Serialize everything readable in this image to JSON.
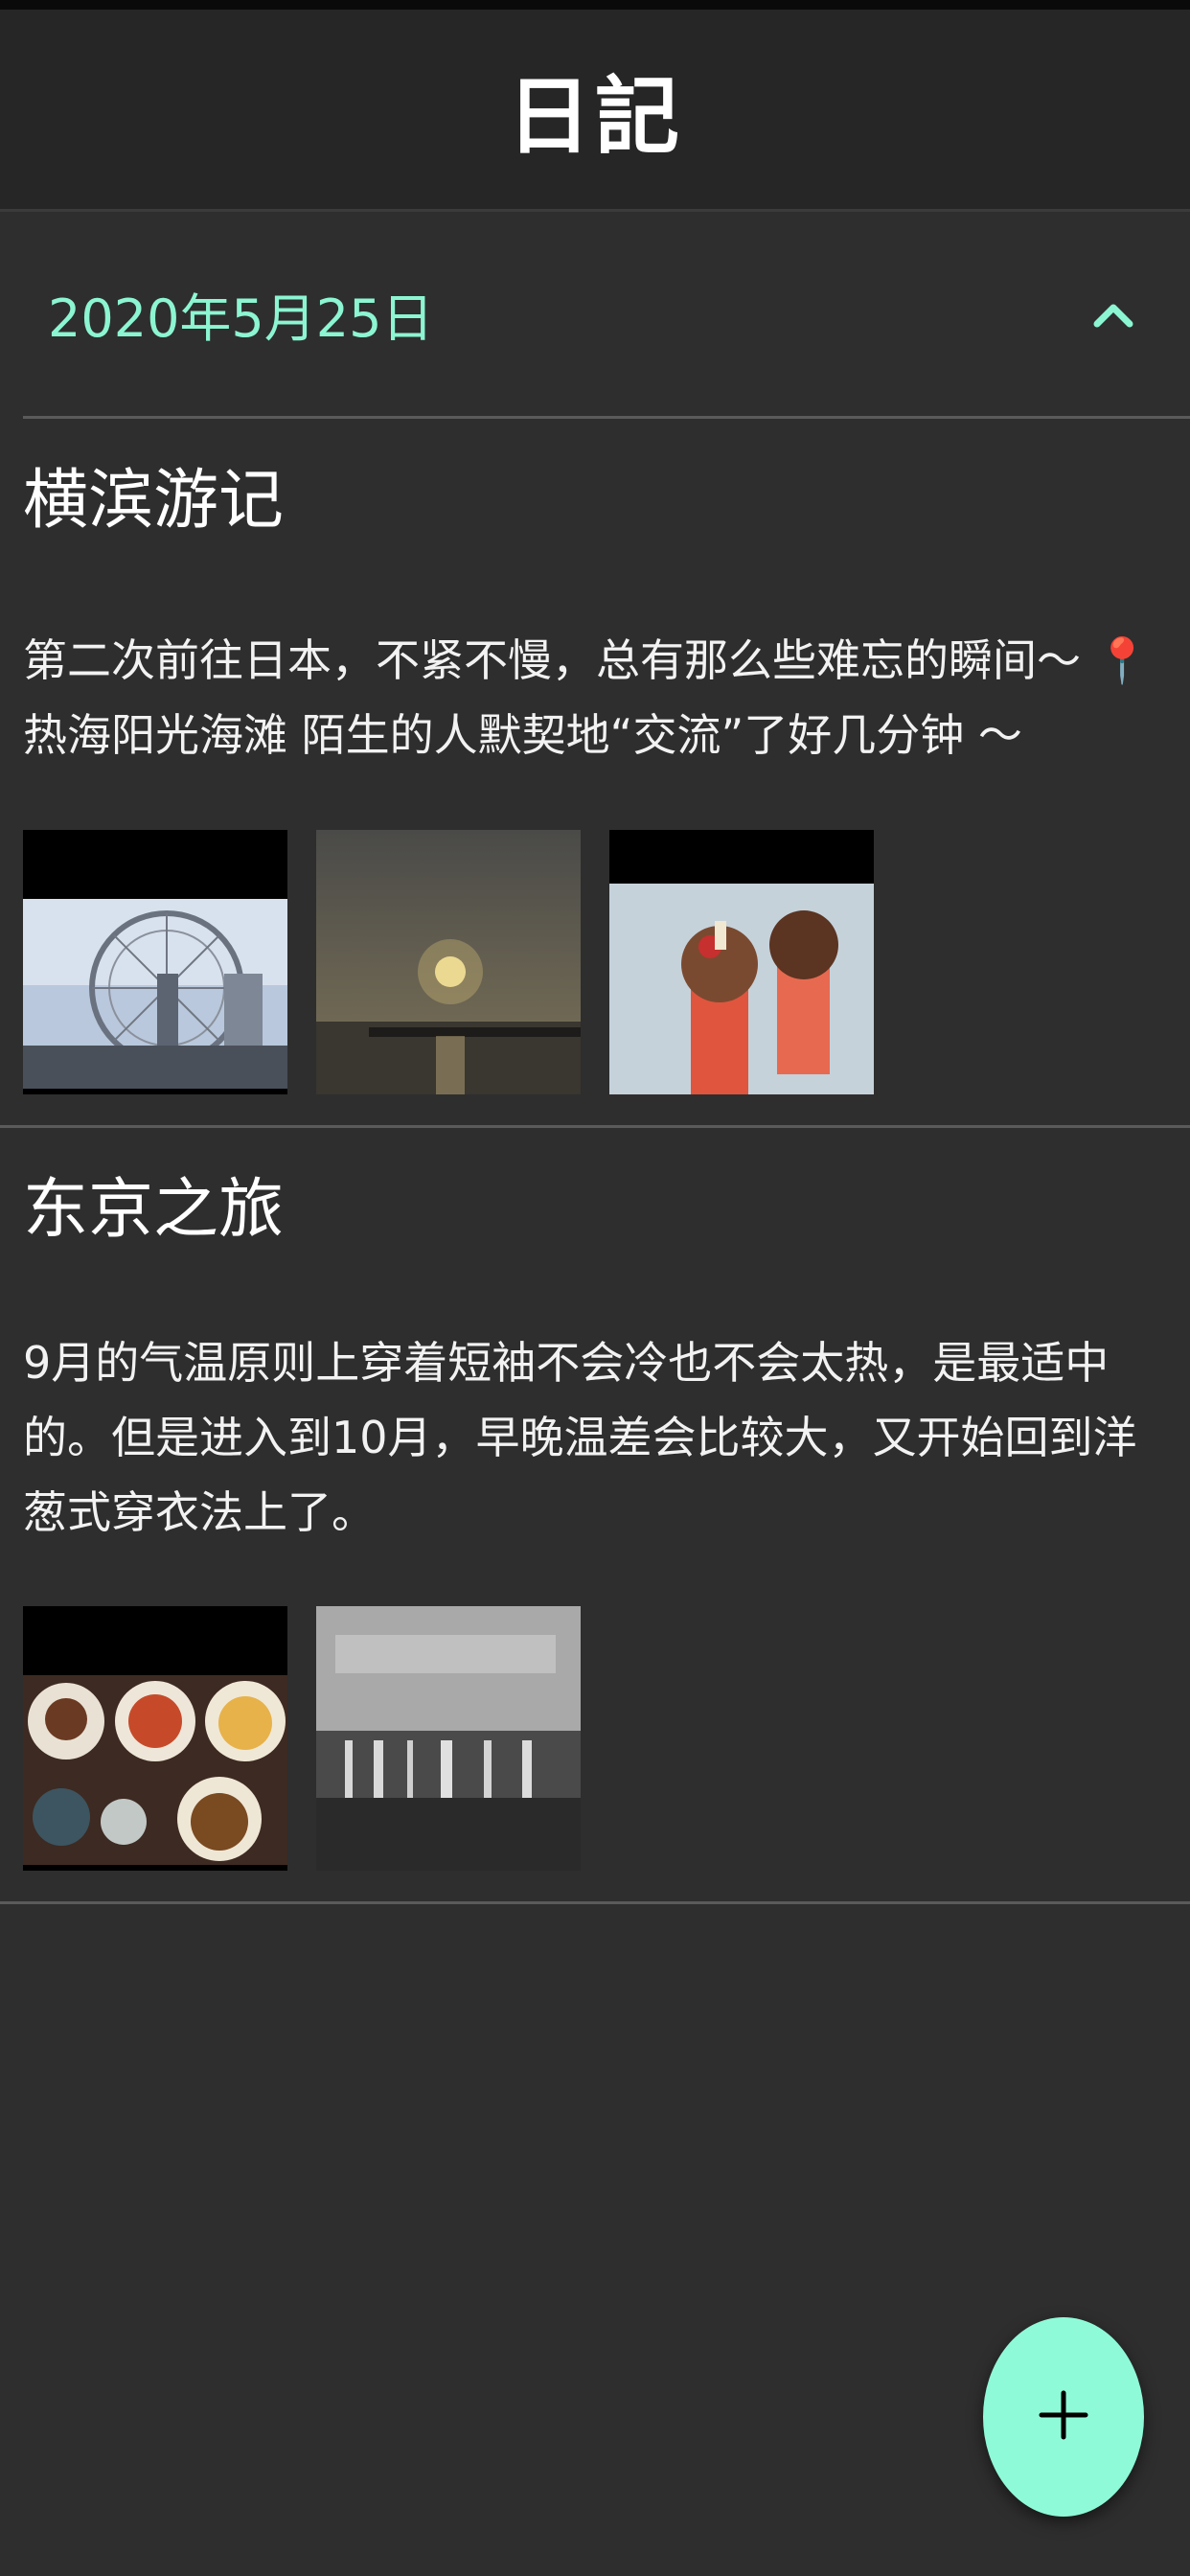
{
  "header": {
    "title": "日記"
  },
  "section": {
    "date": "2020年5月25日",
    "toggle_icon": "chevron-up-icon"
  },
  "entries": [
    {
      "title": "横滨游记",
      "body": "第二次前往日本，不紧不慢，总有那么些难忘的瞬间～ 📍热海阳光海滩 陌生的人默契地“交流”了好几分钟 ～",
      "photos": [
        "ferris-wheel-photo",
        "sunset-sea-photo",
        "ice-cream-photo"
      ]
    },
    {
      "title": "东京之旅",
      "body": "9月的气温原则上穿着短袖不会冷也不会太热，是最适中的。但是进入到10月，早晚温差会比较大，又开始回到洋葱式穿衣法上了。",
      "photos": [
        "food-collage-photo",
        "waterfall-photo"
      ]
    }
  ],
  "fab": {
    "icon": "plus-icon"
  },
  "colors": {
    "accent": "#8cf5d2",
    "fab": "#8ffad8",
    "background": "#2e2e2e",
    "header": "#262626"
  }
}
